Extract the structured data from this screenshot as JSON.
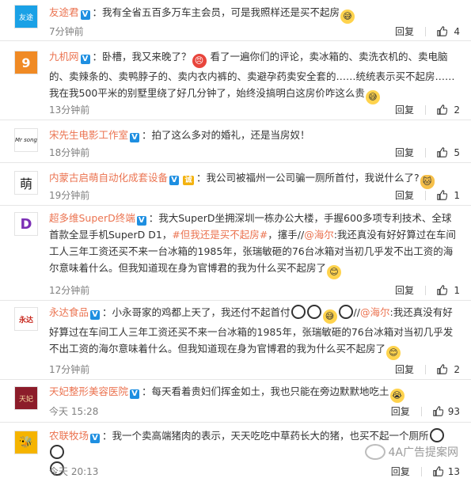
{
  "comments": [
    {
      "user": "友途君",
      "badge": "V",
      "text": "：我有全省五百多万车主会员，可是我照样还是买不起房",
      "time": "7分钟前",
      "reply_label": "回复",
      "likes": "4",
      "avatar_text": "友途"
    },
    {
      "user": "九机网",
      "badge": "V",
      "text_a": "：卧槽，我又来晚了？",
      "text_b": "看了一遍你们的评论，卖冰箱的、卖洗衣机的、卖电脑的、卖辣条的、卖鸭脖子的、卖内衣内裤的、卖避孕药卖安全套的……统统表示买不起房……我在我500平米的别墅里绕了好几分钟了，始终没搞明白这房价咋这么贵",
      "time": "13分钟前",
      "reply_label": "回复",
      "likes": "2",
      "avatar_text": "9"
    },
    {
      "user": "宋先生电影工作室",
      "badge": "V",
      "text": "：拍了这么多对的婚礼，还是当房奴！",
      "time": "18分钟前",
      "reply_label": "回复",
      "likes": "5",
      "avatar_text": "Mr song"
    },
    {
      "user": "内蒙古启萌自动化成套设备",
      "badge": "V",
      "extra_badge": "诚",
      "text": "：我公司被福州一公司骗一厕所首付，我说什么了?",
      "time": "19分钟前",
      "reply_label": "回复",
      "likes": "1",
      "avatar_text": "萌"
    },
    {
      "user": "超多维SuperD终端",
      "badge": "V",
      "text_a": "：我大SuperD坐拥深圳一栋办公大楼，手握600多项专利技术、全球首款全显手机SuperD D1，",
      "topic": "#但我还是买不起房#",
      "text_b": "，㩙手//",
      "mention": "@海尔",
      "text_c": ":我还真没有好好算过在车间工人三年工资还买不来一台冰箱的1985年，张瑞敏砸的76台冰箱对当初几乎发不出工资的海尔意味着什么。但我知道现在身为官博君的我为什么买不起房了",
      "time": "12分钟前",
      "reply_label": "回复",
      "likes": "1",
      "avatar_text": "D"
    },
    {
      "user": "永达食品",
      "badge": "V",
      "text_a": "：小永哥家的鸡都上天了，我还付不起首付",
      "text_b": "//",
      "mention": "@海尔",
      "text_c": ":我还真没有好好算过在车间工人三年工资还买不来一台冰箱的1985年，张瑞敏砸的76台冰箱对当初几乎发不出工资的海尔意味着什么。但我知道现在身为官博君的我为什么买不起房了",
      "time": "17分钟前",
      "reply_label": "回复",
      "likes": "2",
      "avatar_text": "永达"
    },
    {
      "user": "天妃整形美容医院",
      "badge": "V",
      "text": "：每天看着贵妇们挥金如土，我也只能在旁边默默地吃土",
      "time": "今天 15:28",
      "reply_label": "回复",
      "likes": "93",
      "avatar_text": "天妃"
    },
    {
      "user": "农联牧场",
      "badge": "V",
      "text": "：我一个卖高端猪肉的表示，天天吃吃中草药长大的猪，也买不起一个厕所",
      "time": "今天 20:13",
      "reply_label": "回复",
      "likes": "13",
      "avatar_text": "🐝"
    }
  ],
  "watermark": "4A广告提案网",
  "colors": {
    "username": "#eb7350",
    "verified": "#1e8fe1",
    "org_badge": "#f3b20f",
    "meta": "#808080"
  }
}
